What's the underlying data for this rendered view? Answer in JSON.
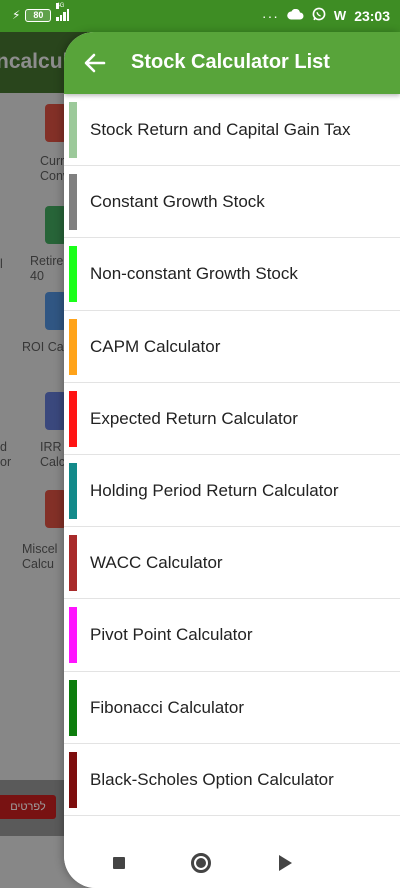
{
  "status_bar": {
    "battery": "80",
    "network_tag": "4G",
    "time": "23:03",
    "more": "···",
    "cloud_icon": "cloud-icon",
    "whatsapp_icon": "whatsapp-icon",
    "w_icon": "W"
  },
  "background": {
    "appbar_title": "ncalcula",
    "tiles": [
      {
        "label": "Curr\nConv"
      },
      {
        "label": "Retire\n40"
      },
      {
        "label": "ROI Ca"
      },
      {
        "label": "IRR\nCalcu"
      },
      {
        "label": "Miscel\nCalcu"
      }
    ],
    "left_edge_text": [
      "l",
      "d",
      "or"
    ],
    "ad_button": "לפרטים"
  },
  "sheet": {
    "title": "Stock Calculator List",
    "back_icon": "arrow-left-icon",
    "items": [
      {
        "label": "Stock Return and Capital Gain Tax",
        "color": "#9cc99a"
      },
      {
        "label": "Constant Growth Stock",
        "color": "#808080"
      },
      {
        "label": "Non-constant Growth Stock",
        "color": "#1aff1a"
      },
      {
        "label": "CAPM Calculator",
        "color": "#ffa31a"
      },
      {
        "label": "Expected Return Calculator",
        "color": "#ff1414"
      },
      {
        "label": "Holding Period Return Calculator",
        "color": "#138a8a"
      },
      {
        "label": "WACC Calculator",
        "color": "#a82a2a"
      },
      {
        "label": "Pivot Point Calculator",
        "color": "#ff14ff"
      },
      {
        "label": "Fibonacci Calculator",
        "color": "#0d7d0d"
      },
      {
        "label": "Black-Scholes Option Calculator",
        "color": "#7d0d0d"
      }
    ]
  },
  "nav_bar": {
    "stop_icon": "square-icon",
    "home_icon": "circle-icon",
    "back_icon": "triangle-icon"
  }
}
